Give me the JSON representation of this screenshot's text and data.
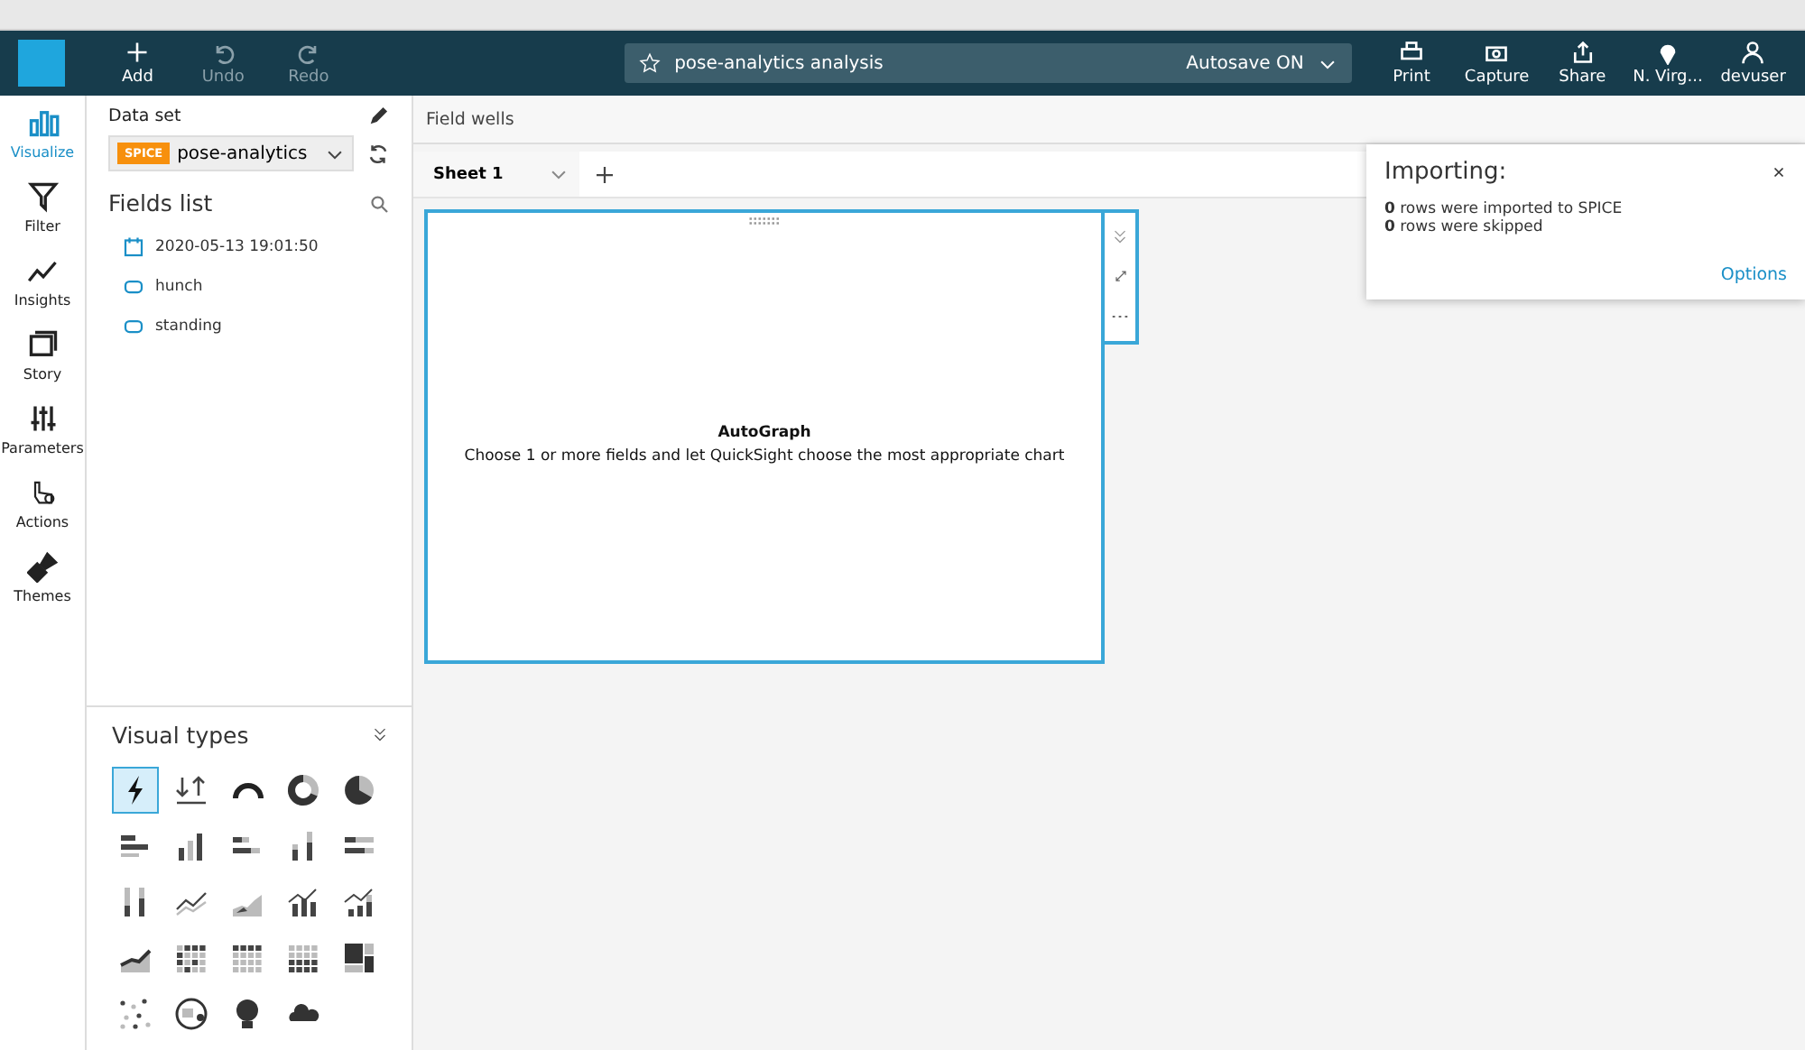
{
  "toolbar": {
    "actions": [
      {
        "label": "Add",
        "disabled": false,
        "kind": "add"
      },
      {
        "label": "Undo",
        "disabled": true,
        "kind": "undo"
      },
      {
        "label": "Redo",
        "disabled": true,
        "kind": "redo"
      }
    ],
    "analysis_title": "pose-analytics analysis",
    "autosave": "Autosave ON",
    "right_actions": [
      {
        "label": "Print",
        "kind": "print"
      },
      {
        "label": "Capture",
        "kind": "camera"
      },
      {
        "label": "Share",
        "kind": "share"
      },
      {
        "label": "N. Virg...",
        "kind": "pin"
      },
      {
        "label": "devuser",
        "kind": "user"
      }
    ]
  },
  "nav": [
    {
      "label": "Visualize",
      "selected": true,
      "kind": "bars"
    },
    {
      "label": "Filter",
      "selected": false,
      "kind": "filter"
    },
    {
      "label": "Insights",
      "selected": false,
      "kind": "insights"
    },
    {
      "label": "Story",
      "selected": false,
      "kind": "story"
    },
    {
      "label": "Parameters",
      "selected": false,
      "kind": "sliders"
    },
    {
      "label": "Actions",
      "selected": false,
      "kind": "actions"
    },
    {
      "label": "Themes",
      "selected": false,
      "kind": "brush"
    }
  ],
  "dataset": {
    "heading": "Data set",
    "badge": "SPICE",
    "name": "pose-analytics"
  },
  "fields": {
    "heading": "Fields list",
    "items": [
      {
        "name": "2020-05-13 19:01:50",
        "kind": "date"
      },
      {
        "name": "hunch",
        "kind": "dimension"
      },
      {
        "name": "standing",
        "kind": "dimension"
      }
    ]
  },
  "visual_types": {
    "heading": "Visual types",
    "items": [
      {
        "kind": "autograph",
        "selected": true
      },
      {
        "kind": "kpi",
        "selected": false
      },
      {
        "kind": "gauge",
        "selected": false
      },
      {
        "kind": "donut",
        "selected": false
      },
      {
        "kind": "pie",
        "selected": false
      },
      {
        "kind": "hbar",
        "selected": false
      },
      {
        "kind": "vbar",
        "selected": false
      },
      {
        "kind": "hstack",
        "selected": false
      },
      {
        "kind": "vstack",
        "selected": false
      },
      {
        "kind": "hfull",
        "selected": false
      },
      {
        "kind": "vfull",
        "selected": false
      },
      {
        "kind": "line",
        "selected": false
      },
      {
        "kind": "area",
        "selected": false
      },
      {
        "kind": "combo",
        "selected": false
      },
      {
        "kind": "combo2",
        "selected": false
      },
      {
        "kind": "stackarea",
        "selected": false
      },
      {
        "kind": "heatmap",
        "selected": false
      },
      {
        "kind": "pivot",
        "selected": false
      },
      {
        "kind": "table",
        "selected": false
      },
      {
        "kind": "treemap",
        "selected": false
      },
      {
        "kind": "scatter",
        "selected": false
      },
      {
        "kind": "map",
        "selected": false
      },
      {
        "kind": "insight",
        "selected": false
      },
      {
        "kind": "cloud",
        "selected": false
      }
    ]
  },
  "field_wells": "Field wells",
  "sheets": [
    {
      "label": "Sheet 1",
      "selected": true
    }
  ],
  "visual": {
    "title": "AutoGraph",
    "hint": "Choose 1 or more fields and let QuickSight choose the most appropriate chart"
  },
  "toast": {
    "title": "Importing:",
    "lines": [
      {
        "count": "0",
        "text": "rows were imported to SPICE"
      },
      {
        "count": "0",
        "text": "rows were skipped"
      }
    ],
    "link": "Options"
  }
}
